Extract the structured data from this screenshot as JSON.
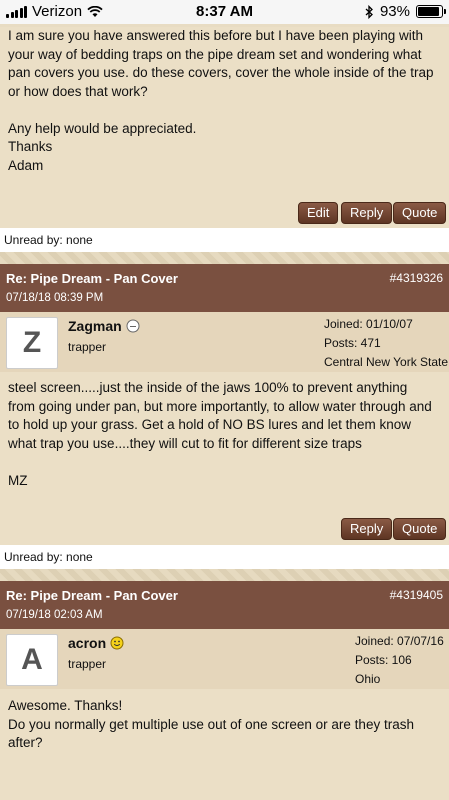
{
  "status_bar": {
    "carrier": "Verizon",
    "time": "8:37 AM",
    "battery": "93%"
  },
  "post1": {
    "body_lines": [
      "I am sure you have answered this before but I have been playing with",
      "your way of bedding traps on the pipe dream set and wondering what",
      "pan covers you use. do these covers, cover the whole inside of the trap",
      "or how does that work?",
      "",
      "Any help would be appreciated.",
      "Thanks",
      "Adam"
    ],
    "edit_label": "Edit",
    "reply_label": "Reply",
    "quote_label": "Quote",
    "unread": "Unread by: none"
  },
  "post2": {
    "title": "Re: Pipe Dream - Pan Cover",
    "number": "#4319326",
    "date": "07/18/18 08:39 PM",
    "avatar_letter": "Z",
    "username": "Zagman",
    "role": "trapper",
    "joined": "Joined: 01/10/07",
    "posts": "Posts: 471",
    "location": "Central New York State",
    "body_lines": [
      "steel screen.....just the inside of the jaws 100% to prevent anything",
      "from going under pan, but more importantly, to allow water through and",
      "to hold up your grass. Get a hold of NO BS lures and let them know",
      "what trap you use....they will cut to fit for different size traps",
      "",
      "MZ"
    ],
    "reply_label": "Reply",
    "quote_label": "Quote",
    "unread": "Unread by: none"
  },
  "post3": {
    "title": "Re: Pipe Dream - Pan Cover",
    "number": "#4319405",
    "date": "07/19/18 02:03 AM",
    "avatar_letter": "A",
    "username": "acron",
    "role": "trapper",
    "joined": "Joined: 07/07/16",
    "posts": "Posts: 106",
    "location": "Ohio",
    "body_lines": [
      "Awesome. Thanks!",
      "Do you normally get multiple use out of one screen or are they trash",
      "after?"
    ]
  },
  "colors": {
    "header_bg": "#7a5040",
    "button_bg": "#6b4230",
    "page_bg": "#ebdfc6",
    "user_box_bg": "#e5d6bb"
  }
}
